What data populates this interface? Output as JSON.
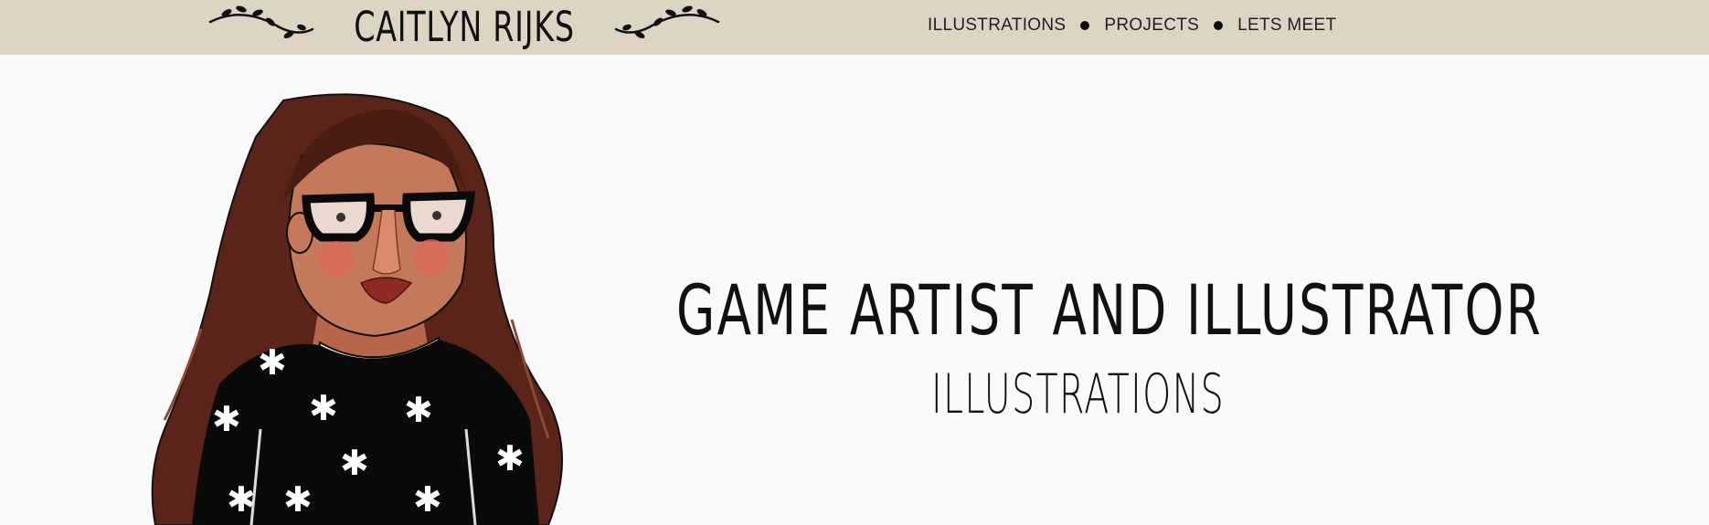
{
  "header": {
    "logo_text": "CAITLYN RIJKS",
    "background": "#ddd4c3",
    "nav": [
      {
        "label": "ILLUSTRATIONS"
      },
      {
        "label": "PROJECTS"
      },
      {
        "label": "LETS MEET"
      }
    ]
  },
  "hero": {
    "title": "GAME ARTIST AND ILLUSTRATOR",
    "subtitle": "ILLUSTRATIONS",
    "portrait_icon": "self-portrait-illustration"
  },
  "colors": {
    "page_bg": "#fafafa",
    "text": "#111111",
    "hair": "#5b2418",
    "skin": "#c47a5a",
    "sweater": "#0a0a0a"
  }
}
